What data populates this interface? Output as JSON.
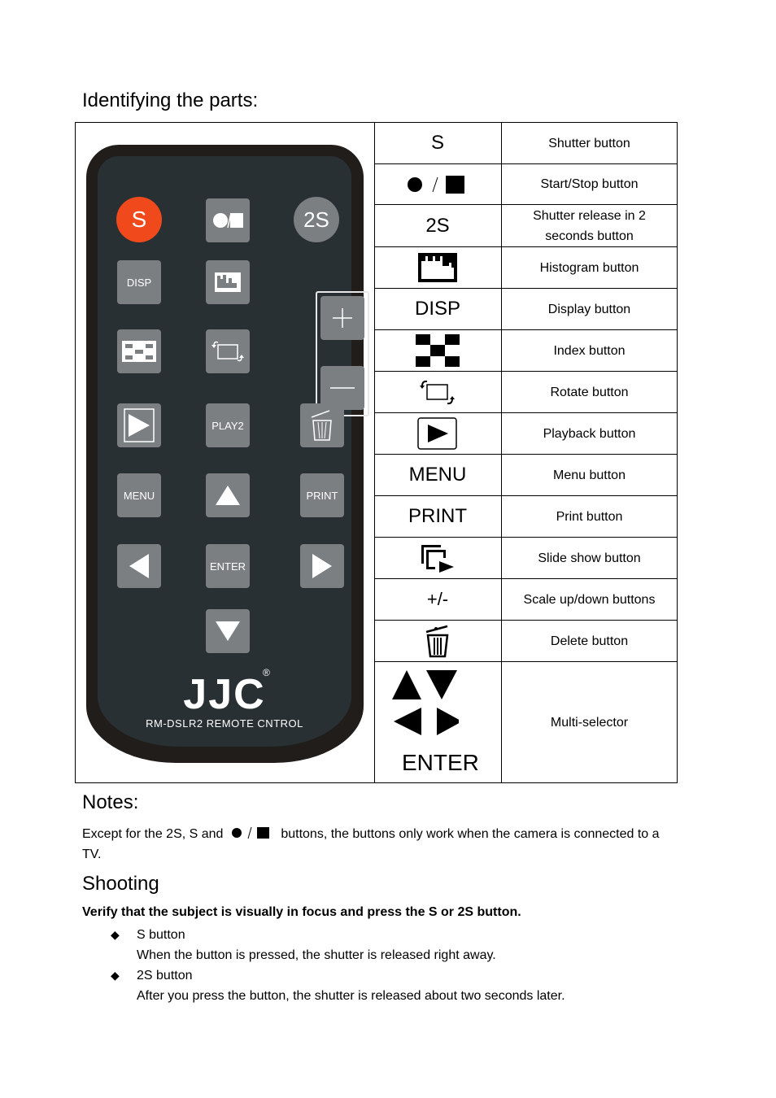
{
  "heading": "Identifying the parts:",
  "remote": {
    "buttons": {
      "s": "S",
      "two_s": "2S",
      "disp": "DISP",
      "play2": "PLAY2",
      "menu": "MENU",
      "print": "PRINT",
      "enter": "ENTER"
    },
    "brand": "JJC",
    "registered": "®",
    "model": "RM-DSLR2 REMOTE CNTROL",
    "colors": {
      "shutter": "#f04a1c",
      "button": "#7c7f82",
      "body": "#211d1b",
      "face": "#283034"
    }
  },
  "parts": [
    {
      "symbol": "S",
      "symbol_type": "text",
      "description": "Shutter button"
    },
    {
      "symbol": "●/■",
      "symbol_type": "start-stop-icon",
      "description": "Start/Stop button"
    },
    {
      "symbol": "2S",
      "symbol_type": "text",
      "description": "Shutter release in 2 seconds button"
    },
    {
      "symbol": "",
      "symbol_type": "histogram-icon",
      "description": "Histogram button"
    },
    {
      "symbol": "DISP",
      "symbol_type": "text",
      "description": "Display button"
    },
    {
      "symbol": "",
      "symbol_type": "index-icon",
      "description": "Index button"
    },
    {
      "symbol": "",
      "symbol_type": "rotate-icon",
      "description": "Rotate button"
    },
    {
      "symbol": "",
      "symbol_type": "playback-icon",
      "description": "Playback button"
    },
    {
      "symbol": "MENU",
      "symbol_type": "text",
      "description": "Menu button"
    },
    {
      "symbol": "PRINT",
      "symbol_type": "text",
      "description": "Print button"
    },
    {
      "symbol": "",
      "symbol_type": "slideshow-icon",
      "description": "Slide show button"
    },
    {
      "symbol": "+/-",
      "symbol_type": "text",
      "description": "Scale up/down buttons"
    },
    {
      "symbol": "",
      "symbol_type": "trash-icon",
      "description": "Delete button"
    },
    {
      "symbol": "ENTER",
      "symbol_type": "multi-selector-icon",
      "description": "Multi-selector"
    }
  ],
  "notes": {
    "heading": "Notes:",
    "text_before": "Except for the 2S, S and",
    "text_after": "buttons, the buttons only work when the camera is connected to a",
    "text_wrap": "TV."
  },
  "shooting": {
    "heading": "Shooting",
    "instruction": "Verify that the subject is visually in focus and press the S or 2S button.",
    "items": [
      {
        "title": "S button",
        "detail": "When the button is pressed, the shutter is released right away."
      },
      {
        "title": "2S button",
        "detail": "After you press the button, the shutter is released about two seconds later."
      }
    ]
  }
}
